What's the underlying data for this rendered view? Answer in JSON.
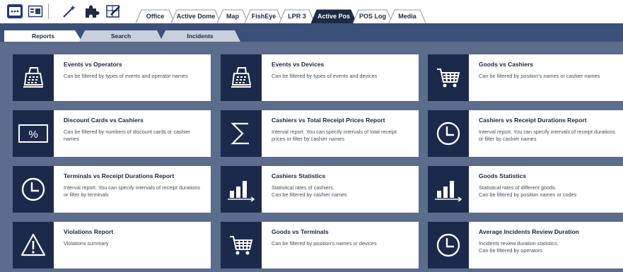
{
  "toolbar": {
    "icons": [
      "grid-menu-icon",
      "panel-layout-icon",
      "magic-wand-icon",
      "puzzle-icon",
      "edit-layout-icon"
    ],
    "tabs": [
      {
        "label": "Office",
        "active": false
      },
      {
        "label": "Active Dome",
        "active": false
      },
      {
        "label": "Map",
        "active": false
      },
      {
        "label": "FishEye",
        "active": false
      },
      {
        "label": "LPR 3",
        "active": false
      },
      {
        "label": "Active Pos",
        "active": true
      },
      {
        "label": "POS Log",
        "active": false
      },
      {
        "label": "Media",
        "active": false
      }
    ]
  },
  "subtabs": [
    {
      "label": "Reports",
      "active": true
    },
    {
      "label": "Search",
      "active": false
    },
    {
      "label": "Incidents",
      "active": false
    }
  ],
  "colors": {
    "band": "#3a5078",
    "content_bg": "#5b6c8d",
    "icon_tile": "#1b2a4b",
    "active_tab": "#1e2b45"
  },
  "reports": [
    {
      "title": "Events vs Operators",
      "desc": "Can be filtered by types of events and operator names",
      "icon": "cash-register-icon"
    },
    {
      "title": "Events vs Devices",
      "desc": "Can be filtered by types of events and devices",
      "icon": "cash-register-icon"
    },
    {
      "title": "Goods vs Cashiers",
      "desc": "Can be filtered by position's names or cashier names",
      "icon": "shopping-cart-icon"
    },
    {
      "title": "Discount Cards vs Cashiers",
      "desc": "Can be filtered by numbers of discount cards or cashier names",
      "icon": "percent-card-icon"
    },
    {
      "title": "Cashiers vs Total Receipt Prices Report",
      "desc": "Interval report. You can specify intervals of total receipt prices or filter by cashier names",
      "icon": "sigma-icon"
    },
    {
      "title": "Cashiers vs Receipt Durations Report",
      "desc": "Interval report. You can specify intervals of receipt durations or filter by cashier names",
      "icon": "clock-icon"
    },
    {
      "title": "Terminals vs Receipt Durations Report",
      "desc": "Interval report. You can specify intervals of receipt durations or filter by terminals",
      "icon": "clock-icon"
    },
    {
      "title": "Cashiers Statistics",
      "desc": "Statisitcal rates of cashiers.\nCan be filtered by cashier names",
      "icon": "bar-chart-icon"
    },
    {
      "title": "Goods Statistics",
      "desc": "Statisitcal rates of different goods.\nCan be filtered by position names or codes",
      "icon": "bar-chart-icon"
    },
    {
      "title": "Violations Report",
      "desc": "Violations summary",
      "icon": "warning-icon"
    },
    {
      "title": "Goods vs Terminals",
      "desc": "Can be filtered by position's names or devices",
      "icon": "shopping-cart-icon"
    },
    {
      "title": "Average Incidents Review Duration",
      "desc": "Incidents review duration statistics.\nCan be filtered by operators",
      "icon": "clock-icon"
    }
  ]
}
